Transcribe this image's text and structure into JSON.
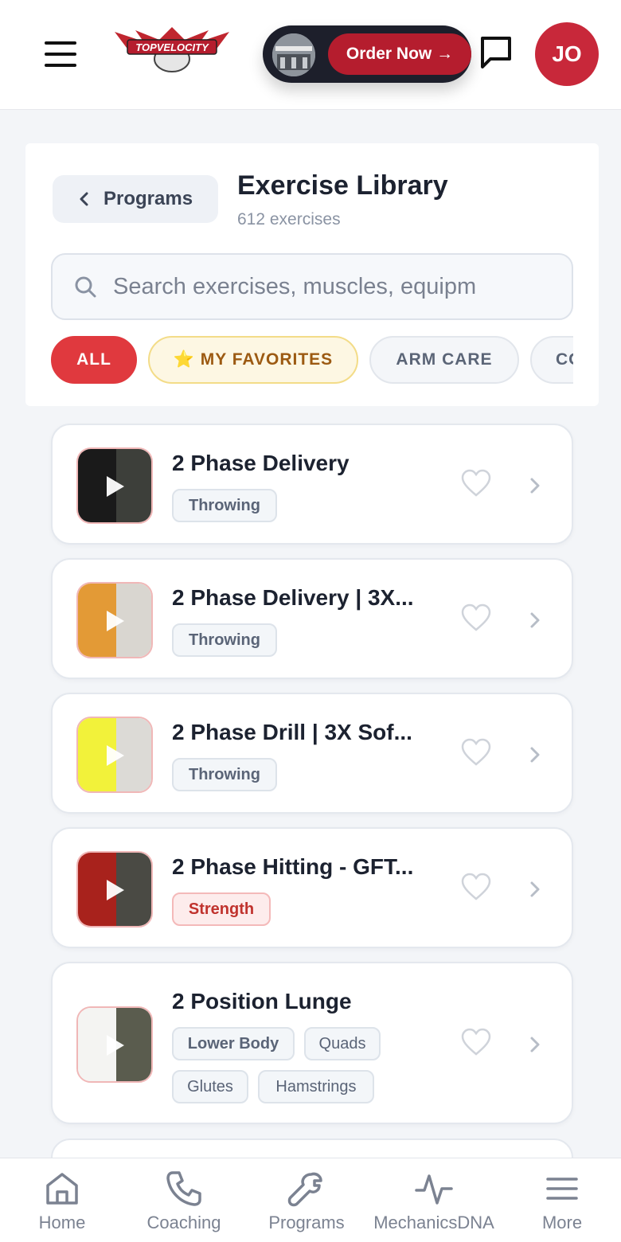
{
  "header": {
    "logo_text": "TOPVELOCITY",
    "promo_button": "Order Now →",
    "avatar_initials": "JO"
  },
  "library": {
    "back_label": "Programs",
    "title": "Exercise Library",
    "count": "612 exercises",
    "search_placeholder": "Search exercises, muscles, equipm",
    "filters": [
      {
        "label": "ALL"
      },
      {
        "label": "⭐ MY FAVORITES"
      },
      {
        "label": "ARM CARE"
      },
      {
        "label": "CO"
      }
    ]
  },
  "exercises": [
    {
      "name": "2 Phase Delivery",
      "tags": [
        "Throwing"
      ]
    },
    {
      "name": "2 Phase Delivery | 3X...",
      "tags": [
        "Throwing"
      ]
    },
    {
      "name": "2 Phase Drill | 3X Sof...",
      "tags": [
        "Throwing"
      ]
    },
    {
      "name": "2 Phase Hitting - GFT...",
      "tags": [
        "Strength"
      ]
    },
    {
      "name": "2 Position Lunge",
      "tags": [
        "Lower Body",
        "Quads",
        "Glutes",
        "Hamstrings"
      ]
    }
  ],
  "nav": [
    {
      "label": "Home",
      "icon": "home-icon"
    },
    {
      "label": "Coaching",
      "icon": "phone-icon"
    },
    {
      "label": "Programs",
      "icon": "wrench-icon"
    },
    {
      "label": "MechanicsDNA",
      "icon": "activity-icon"
    },
    {
      "label": "More",
      "icon": "menu-icon"
    }
  ],
  "colors": {
    "accent": "#e0393e",
    "brand_red": "#b51d2e",
    "avatar": "#c8283a"
  }
}
